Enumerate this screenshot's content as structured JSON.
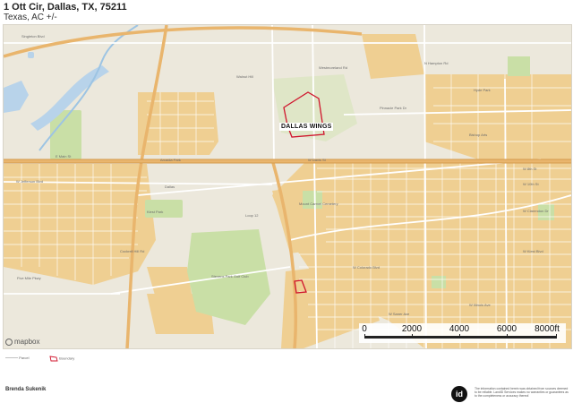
{
  "header": {
    "title": "1 Ott Cir, Dallas, TX, 75211",
    "subtitle": "Texas,  AC +/-"
  },
  "map": {
    "poi_label": "DALLAS WINGS",
    "attribution": "mapbox",
    "scale_labels": [
      "0",
      "2000",
      "4000",
      "6000",
      "8000ft"
    ],
    "street_labels": {
      "main": "E Main St",
      "arcadia": "Arcadia Park",
      "davis": "W Davis St",
      "jefferson": "W Jefferson Blvd",
      "singleton": "Singleton Blvd",
      "pinnacle": "Pinnacle Park Dr",
      "kiest": "W Kiest Blvd",
      "illinois": "W Illinois Ave",
      "colorado": "W Colorado Blvd",
      "westmoreland": "Westmoreland Rd",
      "cockrell": "Cockrell Hill Rd",
      "hampton": "N Hampton Rd",
      "eighth": "W 8th St",
      "tenth": "W 10th St",
      "clarendon": "W Clarendon Dr",
      "saner": "W Saner Ave",
      "fivemile": "Five Mile Pkwy",
      "kiestpark": "Kiest Park",
      "golf": "Stevens Park Golf Club",
      "mountcreek": "Mount Carmel Cemetery",
      "wing": "Walnut Hill",
      "hyde": "Hyde Park",
      "bishop": "Bishop Arts",
      "eastbelt": "Loop 12",
      "dallas": "Dallas"
    },
    "colors": {
      "residential": "#efcf92",
      "park": "#c9dfa6",
      "water": "#b8d3ea",
      "boundary": "#d0142c",
      "highway": "#e9b56d",
      "road": "#ffffff"
    }
  },
  "legend": {
    "items": [
      "Parcel",
      "Boundary"
    ]
  },
  "footer": {
    "agent_name": "Brenda Sukenik",
    "logo_text": "id",
    "disclaimer": "The information contained herein was obtained from sources deemed to be reliable. LandID Services makes no warranties or guarantees as to the completeness or accuracy thereof."
  }
}
